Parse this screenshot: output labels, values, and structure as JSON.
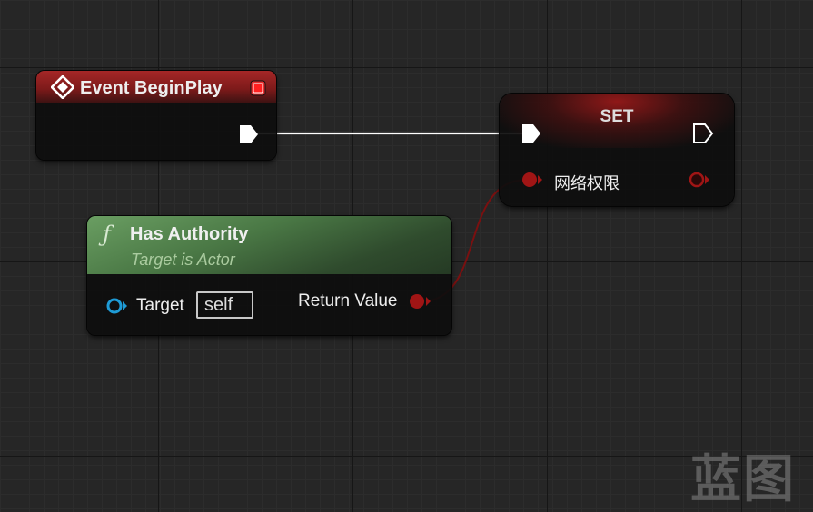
{
  "graph": {
    "nodes": {
      "event_begin_play": {
        "title": "Event BeginPlay",
        "header_color": "#a52727",
        "icon": "diamond-event-icon"
      },
      "set": {
        "title": "SET",
        "variable_label": "网络权限",
        "header_color": "#8c1b1b"
      },
      "has_authority": {
        "function_icon": "ƒ",
        "title": "Has Authority",
        "subtitle": "Target is Actor",
        "target_label": "Target",
        "target_default": "self",
        "return_label": "Return Value",
        "header_color": "#5f8f57"
      }
    },
    "wires": {
      "exec_color": "#ffffff",
      "bool_color": "#8c1010"
    }
  },
  "watermark": "蓝图",
  "colors": {
    "background": "#262626",
    "bool_pin": "#a01515",
    "object_pin": "#1e9bd6",
    "exec_pin": "#ffffff"
  }
}
